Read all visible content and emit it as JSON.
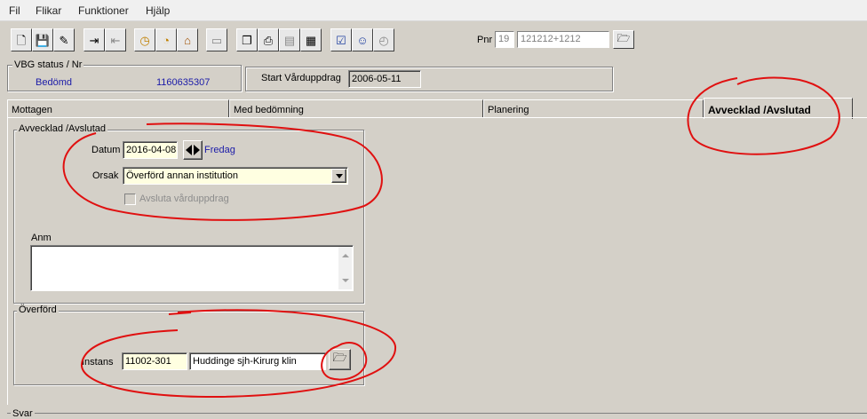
{
  "menu": [
    "Fil",
    "Flikar",
    "Funktioner",
    "Hjälp"
  ],
  "toolbar": {
    "icons": [
      "new-document-icon",
      "save-icon",
      "edit-icon",
      "import-icon",
      "export-icon",
      "clock-icon",
      "timer-icon",
      "house-icon",
      "blank-icon",
      "copy-icon",
      "print-icon",
      "preview-icon",
      "calculator-icon",
      "checklist-icon",
      "smiley-icon",
      "document-clock-icon"
    ],
    "pnr_label": "Pnr",
    "pnr_century": "19",
    "pnr_number": "121212+1212"
  },
  "vbg": {
    "legend": "VBG status / Nr",
    "status": "Bedömd",
    "number": "1160635307"
  },
  "start": {
    "label": "Start Vårduppdrag",
    "date": "2006-05-11"
  },
  "tabs": [
    "Mottagen",
    "Med bedömning",
    "Planering",
    "Avvecklad /Avslutad"
  ],
  "avveck": {
    "legend": "Avvecklad /Avslutad",
    "datum_label": "Datum",
    "datum_value": "2016-04-08",
    "weekday": "Fredag",
    "orsak_label": "Orsak",
    "orsak_value": "Överförd annan institution",
    "checkbox_label": "Avsluta vårduppdrag"
  },
  "anm": {
    "label": "Anm",
    "value": ""
  },
  "overford": {
    "legend": "Överförd",
    "instans_label": "Instans",
    "instans_code": "11002-301",
    "instans_name": "Huddinge sjh-Kirurg klin"
  },
  "svar": {
    "legend": "Svar"
  },
  "colors": {
    "window": "#d4d0c8",
    "field_yellow": "#ffffe1",
    "value_blue": "#1a1aa8",
    "annotation_red": "#e01010"
  }
}
